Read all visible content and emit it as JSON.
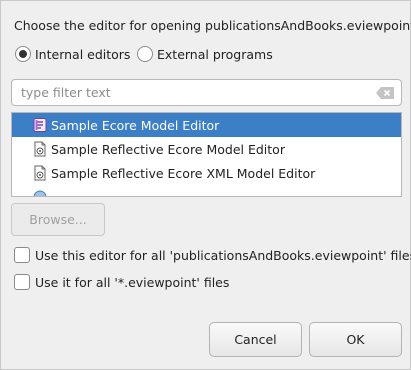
{
  "dialog": {
    "heading": "Choose the editor for opening publicationsAndBooks.eviewpoint:"
  },
  "editor_type": {
    "options": [
      {
        "label": "Internal editors",
        "selected": true
      },
      {
        "label": "External programs",
        "selected": false
      }
    ]
  },
  "filter": {
    "placeholder": "type filter text",
    "value": "",
    "clear_icon": "clear-filter-icon"
  },
  "editors": {
    "items": [
      {
        "label": "Sample Ecore Model Editor",
        "icon": "ecore-model-icon",
        "selected": true
      },
      {
        "label": "Sample Reflective Ecore Model Editor",
        "icon": "reflective-editor-icon",
        "selected": false
      },
      {
        "label": "Sample Reflective Ecore XML Model Editor",
        "icon": "reflective-xml-editor-icon",
        "selected": false
      },
      {
        "label": "",
        "icon": "system-editor-icon",
        "selected": false
      }
    ]
  },
  "browse": {
    "label": "Browse...",
    "enabled": false
  },
  "options": {
    "use_for_file": {
      "label": "Use this editor for all 'publicationsAndBooks.eviewpoint' files",
      "checked": false
    },
    "use_for_extension": {
      "label": "Use it for all '*.eviewpoint' files",
      "checked": false
    }
  },
  "buttons": {
    "cancel": "Cancel",
    "ok": "OK"
  },
  "colors": {
    "selection": "#3d7fc6",
    "background": "#efefef"
  }
}
